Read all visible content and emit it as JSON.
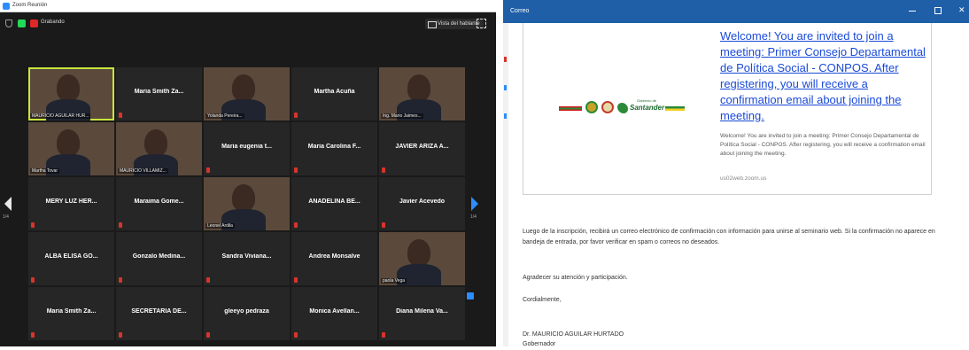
{
  "meeting_window": {
    "title": "Zoom Reunión",
    "record_label": "Grabando",
    "view_button": "Vista del hablante",
    "page_left": "1/4",
    "page_right": "1/4",
    "tiles": [
      {
        "name": "MAURICIO AGUILAR HUR...",
        "kind": "video"
      },
      {
        "name": "Maria Smith Za...",
        "kind": "name"
      },
      {
        "name": "Yolanda Pereira...",
        "kind": "video"
      },
      {
        "name": "Martha Acuña",
        "kind": "name"
      },
      {
        "name": "Ing. Mario Jaimes...",
        "kind": "video"
      },
      {
        "name": "Martha Tovar",
        "kind": "video"
      },
      {
        "name": "MAURICIO VILLAMIZ...",
        "kind": "video"
      },
      {
        "name": "Maria eugenia t...",
        "kind": "name"
      },
      {
        "name": "Maria Carolina F...",
        "kind": "name"
      },
      {
        "name": "JAVIER ARIZA A...",
        "kind": "name"
      },
      {
        "name": "MERY LUZ HER...",
        "kind": "name"
      },
      {
        "name": "Maraima Gome...",
        "kind": "name"
      },
      {
        "name": "Leonel Ardila",
        "kind": "video"
      },
      {
        "name": "ANADELINA BE...",
        "kind": "name"
      },
      {
        "name": "Javier Acevedo",
        "kind": "name"
      },
      {
        "name": "ALBA ELISA GO...",
        "kind": "name"
      },
      {
        "name": "Gonzalo Medina...",
        "kind": "name"
      },
      {
        "name": "Sandra Viviana...",
        "kind": "name"
      },
      {
        "name": "Andrea Monsalve",
        "kind": "name"
      },
      {
        "name": "paola Vega",
        "kind": "video"
      },
      {
        "name": "Maria Smith Za...",
        "kind": "name"
      },
      {
        "name": "SECRETARIA DE...",
        "kind": "name"
      },
      {
        "name": "gleeyo pedraza",
        "kind": "name"
      },
      {
        "name": "Monica Avellan...",
        "kind": "name"
      },
      {
        "name": "Diana Milena Va...",
        "kind": "name"
      }
    ]
  },
  "mail_window": {
    "title": "Correo",
    "close_glyph": "✕",
    "logo_brand": "Santander",
    "logo_sub": "Gobierno de",
    "invite_link": "Welcome! You are invited to join a meeting: Primer Consejo Departamental de Política Social - CONPOS. After registering, you will receive a confirmation email about joining the meeting.",
    "invite_body": "Welcome! You are invited to join a meeting: Primer Consejo Departamental de Política Social - CONPOS. After registering, you will receive a confirmation email about joining the meeting.",
    "invite_url": "us02web.zoom.us",
    "paragraph_1": "Luego de la inscripción, recibirá un correo electrónico de confirmación con información para unirse al seminario web. Si la confirmación no aparece en bandeja de entrada, por favor verificar en spam o correos no deseados.",
    "paragraph_2": "Agradecer su atención y participación.",
    "paragraph_3": "Cordialmente,",
    "signature_name": "Dr. MAURICIO AGUILAR HURTADO",
    "signature_role": "Gobernador"
  }
}
